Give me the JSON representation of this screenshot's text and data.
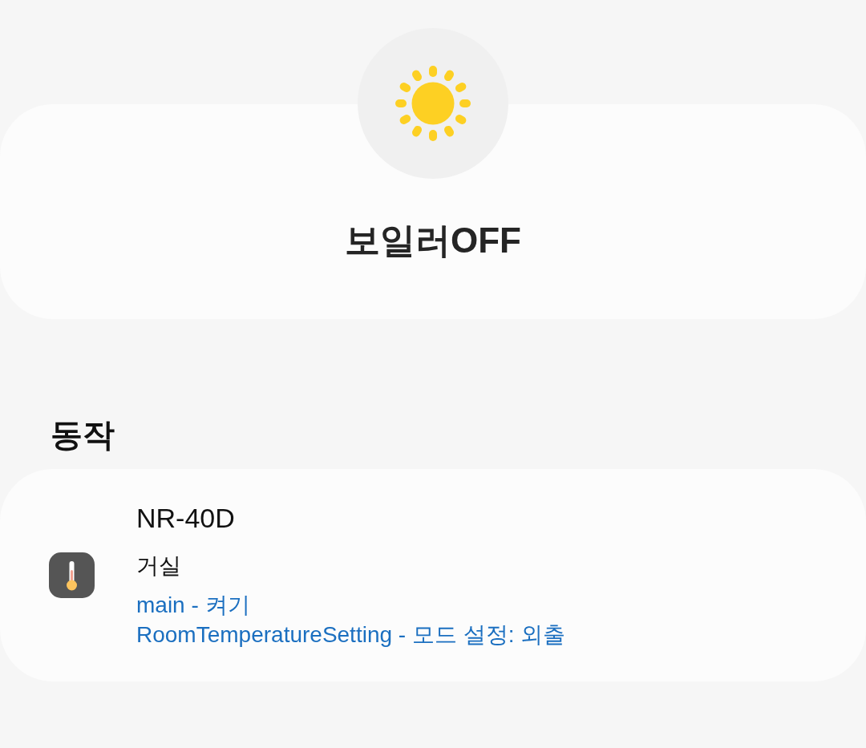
{
  "scene": {
    "title": "보일러OFF"
  },
  "actions_section": {
    "heading": "동작",
    "devices": [
      {
        "name": "NR-40D",
        "room": "거실",
        "actions": [
          "main - 켜기",
          "RoomTemperatureSetting - 모드 설정: 외출"
        ]
      }
    ]
  }
}
